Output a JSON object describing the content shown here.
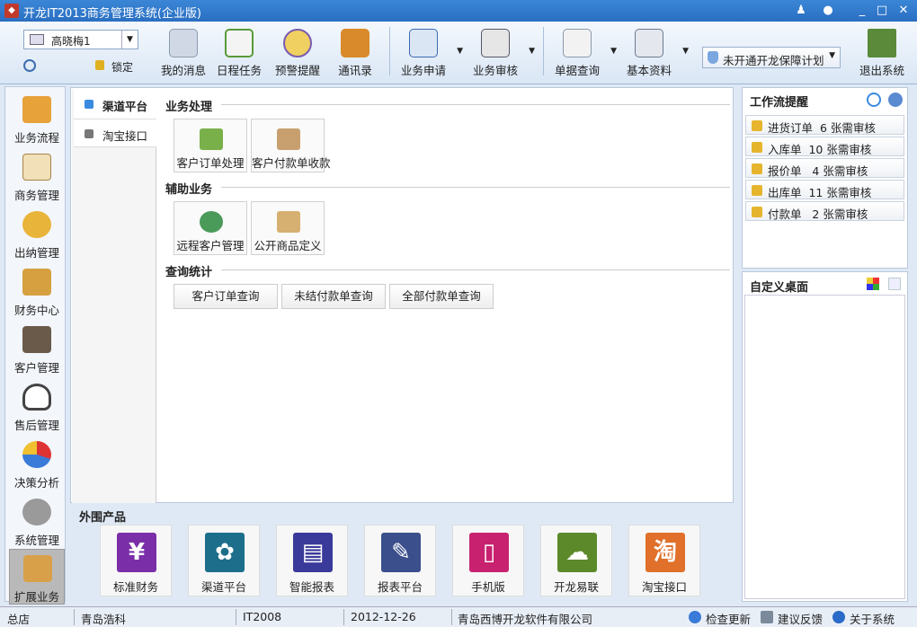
{
  "window": {
    "title": "开龙IT2013商务管理系统(企业版)"
  },
  "toolbar": {
    "user": "高晓梅1",
    "lock_label": "锁定",
    "buttons": [
      {
        "label": "我的消息",
        "icon": "message-envelope-icon"
      },
      {
        "label": "日程任务",
        "icon": "calendar-icon"
      },
      {
        "label": "预警提醒",
        "icon": "alarm-clock-icon"
      },
      {
        "label": "通讯录",
        "icon": "address-book-icon"
      },
      {
        "label": "业务申请",
        "icon": "org-chart-icon"
      },
      {
        "label": "业务审核",
        "icon": "approval-stamp-icon"
      },
      {
        "label": "单据查询",
        "icon": "document-search-icon"
      },
      {
        "label": "基本资料",
        "icon": "notebook-search-icon"
      }
    ],
    "plan_label": "未开通开龙保障计划",
    "exit_label": "退出系统"
  },
  "leftnav": {
    "items": [
      {
        "label": "业务流程",
        "icon": "truck-icon"
      },
      {
        "label": "商务管理",
        "icon": "book-icon"
      },
      {
        "label": "出纳管理",
        "icon": "cashier-coins-icon"
      },
      {
        "label": "财务中心",
        "icon": "scales-icon"
      },
      {
        "label": "客户管理",
        "icon": "customers-icon"
      },
      {
        "label": "售后管理",
        "icon": "headset-icon"
      },
      {
        "label": "决策分析",
        "icon": "pie-chart-icon"
      },
      {
        "label": "系统管理",
        "icon": "gears-icon"
      },
      {
        "label": "扩展业务",
        "icon": "box-icon"
      }
    ]
  },
  "subtabs": [
    {
      "label": "渠道平台"
    },
    {
      "label": "淘宝接口"
    }
  ],
  "sections": {
    "business": {
      "title": "业务处理",
      "cards": [
        {
          "label": "客户订单处理",
          "icon": "customer-order-icon"
        },
        {
          "label": "客户付款单收款",
          "icon": "payment-receipt-icon"
        }
      ]
    },
    "auxiliary": {
      "title": "辅助业务",
      "cards": [
        {
          "label": "远程客户管理",
          "icon": "remote-customer-icon"
        },
        {
          "label": "公开商品定义",
          "icon": "goods-definition-icon"
        }
      ]
    },
    "query": {
      "title": "查询统计",
      "buttons": [
        {
          "label": "客户订单查询"
        },
        {
          "label": "未结付款单查询"
        },
        {
          "label": "全部付款单查询"
        }
      ]
    }
  },
  "external": {
    "title": "外围产品",
    "items": [
      {
        "label": "标准财务",
        "glyph": "¥",
        "color": "#7a2fa8"
      },
      {
        "label": "渠道平台",
        "glyph": "✿",
        "color": "#1d6e8a"
      },
      {
        "label": "智能报表",
        "glyph": "▤",
        "color": "#3a3a9a"
      },
      {
        "label": "报表平台",
        "glyph": "✎",
        "color": "#3b4f8c"
      },
      {
        "label": "手机版",
        "glyph": "▯",
        "color": "#c8216f"
      },
      {
        "label": "开龙易联",
        "glyph": "☁",
        "color": "#5c8a2b"
      },
      {
        "label": "淘宝接口",
        "glyph": "淘",
        "color": "#e0702a"
      }
    ]
  },
  "workflow": {
    "title": "工作流提醒",
    "items": [
      {
        "label": "进货订单  6 张需审核"
      },
      {
        "label": "入库单  10 张需审核"
      },
      {
        "label": "报价单   4 张需审核"
      },
      {
        "label": "出库单  11 张需审核"
      },
      {
        "label": "付款单   2 张需审核"
      }
    ]
  },
  "desktop": {
    "title": "自定义桌面"
  },
  "statusbar": {
    "branch": "总店",
    "company_short": "青岛浩科",
    "product": "IT2008",
    "date": "2012-12-26",
    "vendor": "青岛西博开龙软件有限公司",
    "check_update": "检查更新",
    "feedback": "建议反馈",
    "about": "关于系统"
  }
}
